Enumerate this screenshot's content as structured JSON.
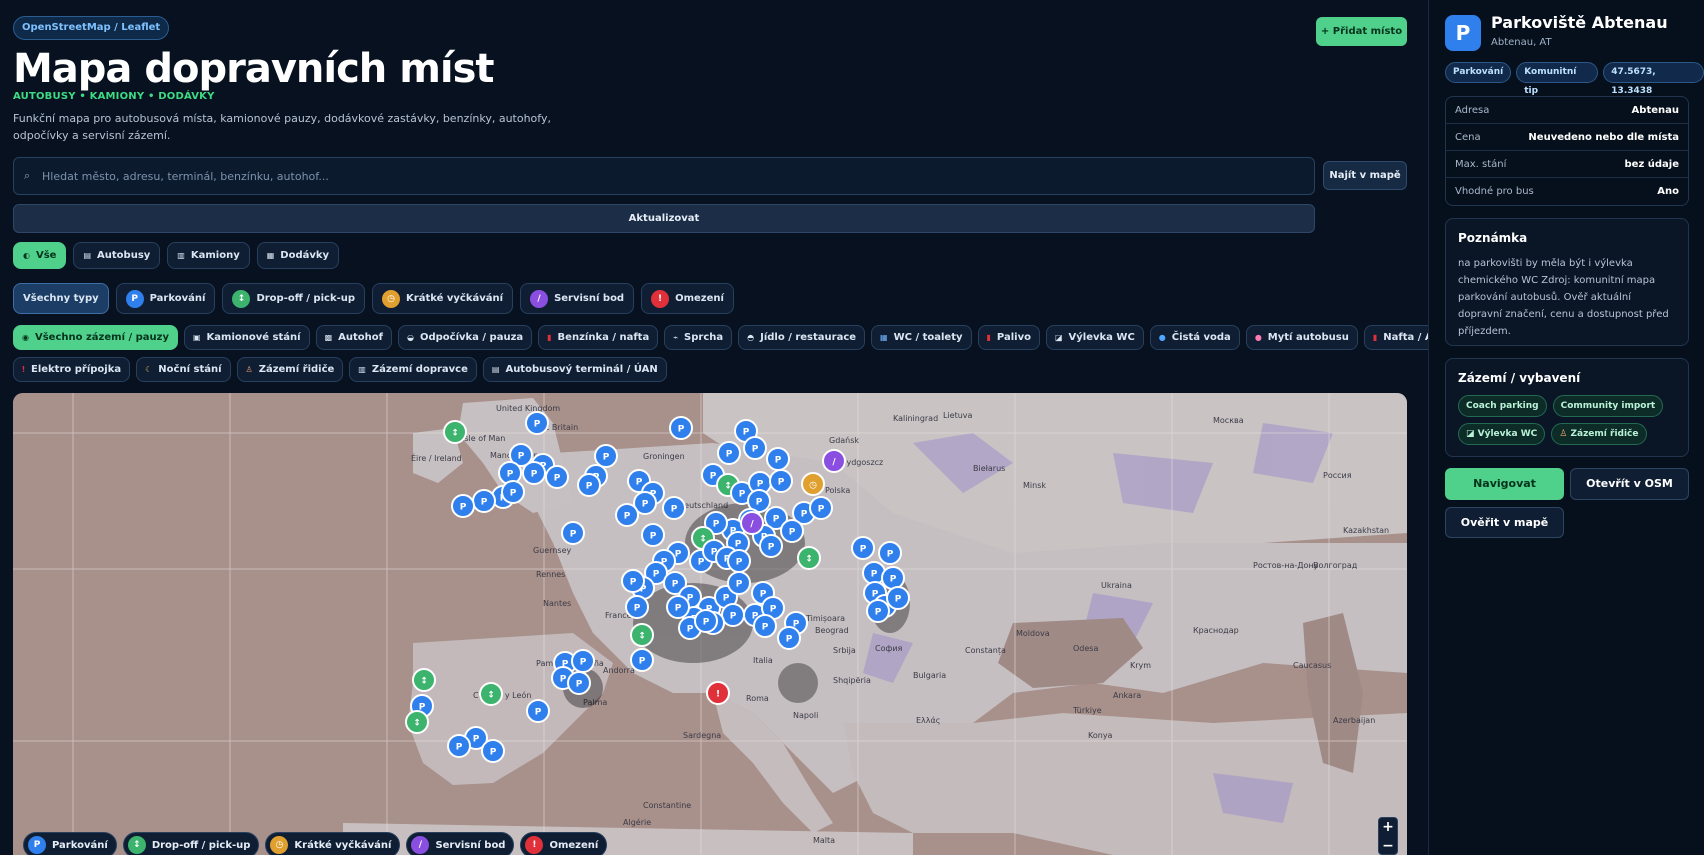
{
  "header": {
    "source_badge": "OpenStreetMap / Leaflet",
    "title": "Mapa dopravních míst",
    "subtitle": "AUTOBUSY • KAMIONY • DODÁVKY",
    "description": "Funkční mapa pro autobusová místa, kamionové pauzy, dodávkové zastávky, benzínky, autohofy, odpočívky a servisní zázemí.",
    "add_button": "+ Přidat místo"
  },
  "search": {
    "placeholder": "Hledat město, adresu, terminál, benzínku, autohof...",
    "value": "",
    "find_button": "Najít v mapě",
    "refresh_button": "Aktualizovat"
  },
  "mode_filters": [
    {
      "label": "Vše",
      "icon": "globe-icon",
      "active": true
    },
    {
      "label": "Autobusy",
      "icon": "bus-icon"
    },
    {
      "label": "Kamiony",
      "icon": "truck-icon"
    },
    {
      "label": "Dodávky",
      "icon": "van-icon"
    }
  ],
  "type_filters": [
    {
      "label": "Všechny typy",
      "active": true
    },
    {
      "label": "Parkování",
      "icon": "parking-icon",
      "glyph": "P",
      "color": "#2f80ed"
    },
    {
      "label": "Drop-off / pick-up",
      "icon": "arrows-icon",
      "glyph": "↕",
      "color": "#3cb46e"
    },
    {
      "label": "Krátké vyčkávání",
      "icon": "clock-icon",
      "glyph": "◷",
      "color": "#e0a030"
    },
    {
      "label": "Servisní bod",
      "icon": "wrench-icon",
      "glyph": "/",
      "color": "#8a4fe0"
    },
    {
      "label": "Omezení",
      "icon": "warning-icon",
      "glyph": "!",
      "color": "#e0303a"
    }
  ],
  "facility_filters_row1": [
    {
      "label": "Všechno zázemí / pauzy",
      "icon": "all-facilities-icon",
      "active": true
    },
    {
      "label": "Kamionové stání",
      "icon": "truck-parking-icon"
    },
    {
      "label": "Autohof",
      "icon": "autohof-icon"
    },
    {
      "label": "Odpočívka / pauza",
      "icon": "rest-icon"
    },
    {
      "label": "Benzínka / nafta",
      "icon": "fuel-station-icon"
    },
    {
      "label": "Sprcha",
      "icon": "shower-icon"
    },
    {
      "label": "Jídlo / restaurace",
      "icon": "food-icon"
    },
    {
      "label": "WC / toalety",
      "icon": "wc-icon"
    },
    {
      "label": "Palivo",
      "icon": "fuel-icon"
    },
    {
      "label": "Výlevka WC",
      "icon": "wc-dump-icon"
    },
    {
      "label": "Čistá voda",
      "icon": "water-icon"
    },
    {
      "label": "Mytí autobusu",
      "icon": "bus-wash-icon"
    },
    {
      "label": "Nafta / AdBlue",
      "icon": "adblue-icon"
    }
  ],
  "facility_filters_row2": [
    {
      "label": "Elektro přípojka",
      "icon": "electric-icon"
    },
    {
      "label": "Noční stání",
      "icon": "moon-icon"
    },
    {
      "label": "Zázemí řidiče",
      "icon": "driver-icon"
    },
    {
      "label": "Zázemí dopravce",
      "icon": "carrier-icon"
    },
    {
      "label": "Autobusový terminál / ÚAN",
      "icon": "terminal-icon"
    }
  ],
  "map": {
    "labels": [
      "United Kingdom",
      "Isle of Man",
      "Éire / Ireland",
      "Great Britain",
      "Manchester",
      "Groningen",
      "Deutschland",
      "Polska",
      "Bydgoszcz",
      "Lietuva",
      "Minsk",
      "Biełarus",
      "Guernsey",
      "Rennes",
      "Nantes",
      "France",
      "Ukraina",
      "Moldova",
      "Odesa",
      "Krym",
      "Pamplona / Iruña",
      "Andorra",
      "Castilla y León",
      "Palma",
      "Beograd",
      "Srbija",
      "Bulgaria",
      "София",
      "Constanța",
      "Shqipëria",
      "Ελλάς",
      "Türkiye",
      "Ankara",
      "Konya",
      "Algérie",
      "Malta",
      "Constantine",
      "Sardegna",
      "Россия",
      "Москва",
      "Ростов-на-Дону",
      "Краснодар",
      "Волгоград",
      "Caucasus",
      "Azerbaijan",
      "Kazakhstan",
      "Italia",
      "Roma",
      "Napoli",
      "Timișoara",
      "Gdańsk",
      "Kaliningrad"
    ],
    "zoom_in": "+",
    "zoom_out": "−"
  },
  "legend": [
    {
      "label": "Parkování",
      "glyph": "P",
      "color": "#2f80ed",
      "icon": "parking-icon"
    },
    {
      "label": "Drop-off / pick-up",
      "glyph": "↕",
      "color": "#3cb46e",
      "icon": "arrows-icon"
    },
    {
      "label": "Krátké vyčkávání",
      "glyph": "◷",
      "color": "#e0a030",
      "icon": "clock-icon"
    },
    {
      "label": "Servisní bod",
      "glyph": "/",
      "color": "#8a4fe0",
      "icon": "wrench-icon"
    },
    {
      "label": "Omezení",
      "glyph": "!",
      "color": "#e0303a",
      "icon": "warning-icon"
    }
  ],
  "detail": {
    "icon_glyph": "P",
    "name": "Parkoviště Abtenau",
    "location": "Abtenau, AT",
    "tags": [
      "Parkování",
      "Komunitní tip",
      "47.5673, 13.3438"
    ],
    "info": [
      {
        "key": "Adresa",
        "value": "Abtenau"
      },
      {
        "key": "Cena",
        "value": "Neuvedeno nebo dle místa"
      },
      {
        "key": "Max. stání",
        "value": "bez údaje"
      },
      {
        "key": "Vhodné pro bus",
        "value": "Ano"
      }
    ],
    "note_title": "Poznámka",
    "note_text": "na parkovišti by měla být i výlevka chemického WC Zdroj: komunitní mapa parkování autobusů. Ověř aktuální dopravní značení, cenu a dostupnost před příjezdem.",
    "equip_title": "Zázemí / vybavení",
    "equip_tags": [
      "Coach parking",
      "Community import",
      "Výlevka WC",
      "Zázemí řidiče"
    ],
    "navigate_button": "Navigovat",
    "osm_button": "Otevřít v OSM",
    "verify_button": "Ověřit v mapě"
  },
  "colors": {
    "accent_green": "#4fd08b",
    "parking_blue": "#2f80ed",
    "background": "#07111f"
  }
}
